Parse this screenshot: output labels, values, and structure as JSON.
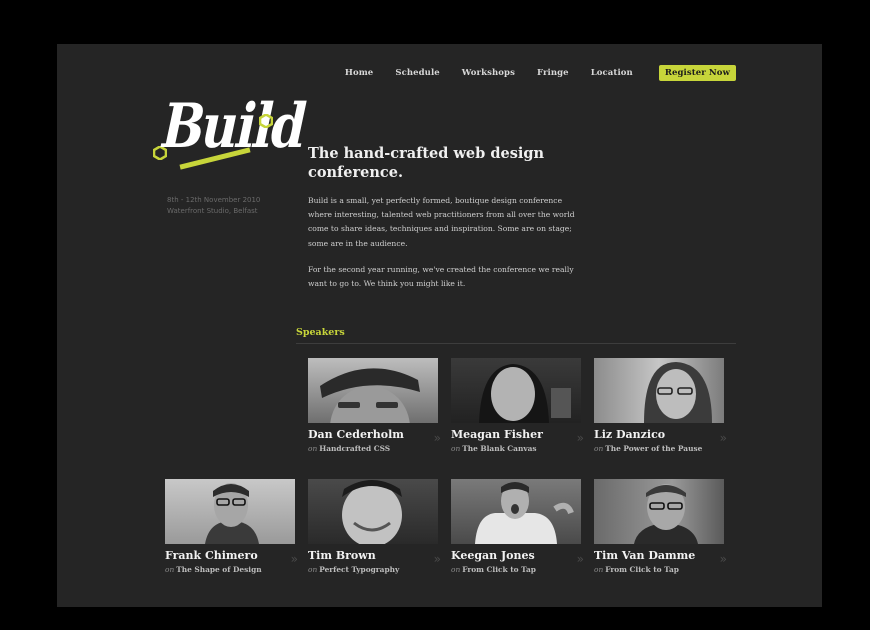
{
  "nav": {
    "items": [
      "Home",
      "Schedule",
      "Workshops",
      "Fringe",
      "Location"
    ],
    "register_label": "Register Now"
  },
  "logo": {
    "text": "Build",
    "accent_color": "#c7d53a"
  },
  "event": {
    "dates": "8th - 12th November 2010",
    "venue": "Waterfront Studio, Belfast"
  },
  "intro": {
    "heading": "The hand-crafted web design conference.",
    "paragraph1": "Build is a small, yet perfectly formed, boutique design conference where interesting, talented web practitioners from all over the world come to share ideas, techniques and inspiration. Some are on stage; some are in the audience.",
    "paragraph2": "For the second year running, we've created the conference we really want to go to. We think you might like it."
  },
  "speakers": {
    "heading": "Speakers",
    "on_prefix": "on",
    "arrow_icon": "double-chevron-right-icon",
    "list": [
      {
        "name": "Dan Cederholm",
        "talk": "Handcrafted CSS"
      },
      {
        "name": "Meagan Fisher",
        "talk": "The Blank Canvas"
      },
      {
        "name": "Liz Danzico",
        "talk": "The Power of the Pause"
      },
      {
        "name": "Frank Chimero",
        "talk": "The Shape of Design"
      },
      {
        "name": "Tim Brown",
        "talk": "Perfect Typography"
      },
      {
        "name": "Keegan Jones",
        "talk": "From Click to Tap"
      },
      {
        "name": "Tim Van Damme",
        "talk": "From Click to Tap"
      }
    ]
  },
  "colors": {
    "background": "#252525",
    "accent": "#c7d53a",
    "frame": "#000000"
  }
}
